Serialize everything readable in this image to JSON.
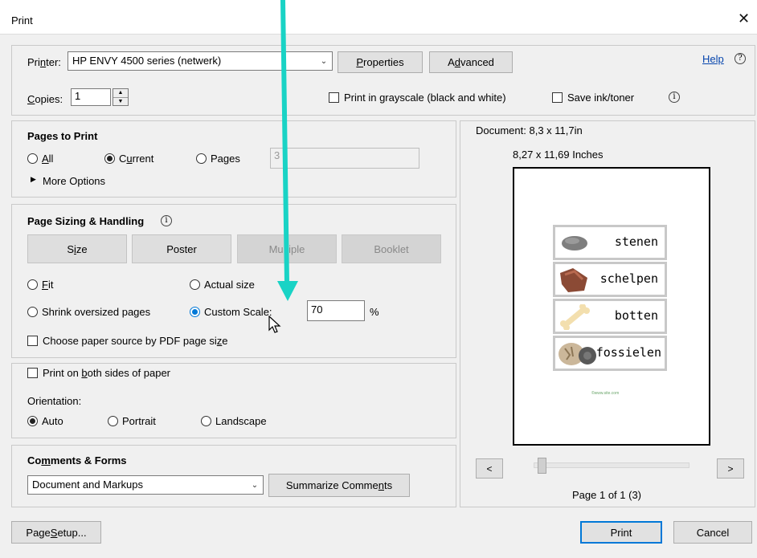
{
  "window": {
    "title": "Print",
    "close_glyph": "✕"
  },
  "printer": {
    "label": "Printer:",
    "selected": "HP ENVY 4500 series (netwerk)",
    "properties": "Properties",
    "advanced": "Advanced",
    "help": "Help"
  },
  "copies": {
    "label": "Copies:",
    "value": "1",
    "grayscale": "Print in grayscale (black and white)",
    "save_ink": "Save ink/toner"
  },
  "pages_to_print": {
    "heading": "Pages to Print",
    "all": "All",
    "current": "Current",
    "pages": "Pages",
    "pages_value": "3",
    "more_options": "More Options"
  },
  "sizing": {
    "heading": "Page Sizing & Handling",
    "tabs": [
      "Size",
      "Poster",
      "Multiple",
      "Booklet"
    ],
    "fit": "Fit",
    "actual_size": "Actual size",
    "shrink": "Shrink oversized pages",
    "custom_scale": "Custom Scale:",
    "scale_value": "70",
    "percent": "%",
    "paper_source": "Choose paper source by PDF page size"
  },
  "duplex": {
    "both_sides": "Print on both sides of paper",
    "orientation_label": "Orientation:",
    "auto": "Auto",
    "portrait": "Portrait",
    "landscape": "Landscape"
  },
  "comments": {
    "heading": "Comments & Forms",
    "selected": "Document and Markups",
    "summarize": "Summarize Comments"
  },
  "preview": {
    "document_size": "Document: 8,3 x 11,7in",
    "paper_size": "8,27 x 11,69 Inches",
    "words": [
      "stenen",
      "schelpen",
      "botten",
      "fossielen"
    ],
    "footer_text": "©www.site.com",
    "prev": "<",
    "next": ">",
    "page_indicator": "Page 1 of 1 (3)",
    "slider_position": 0.03
  },
  "footer": {
    "page_setup": "Page Setup...",
    "print": "Print",
    "cancel": "Cancel"
  },
  "colors": {
    "accent": "#0078d7",
    "annotation_arrow": "#19d3c5"
  }
}
